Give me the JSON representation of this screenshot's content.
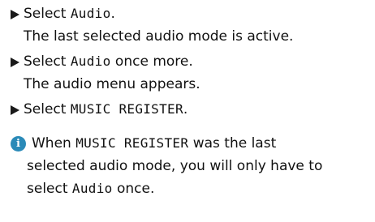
{
  "steps": [
    {
      "line1_prefix": "Select ",
      "line1_code": "Audio",
      "line1_suffix": ".",
      "line2": "The last selected audio mode is active."
    },
    {
      "line1_prefix": "Select ",
      "line1_code": "Audio",
      "line1_suffix": " once more.",
      "line2": "The audio menu appears."
    },
    {
      "line1_prefix": "Select ",
      "line1_code": "MUSIC REGISTER",
      "line1_suffix": "."
    }
  ],
  "info": {
    "icon": "info-icon",
    "icon_glyph": "i",
    "icon_color": "#2a8ab8",
    "line1_prefix": "When ",
    "line1_code": "MUSIC REGISTER",
    "line1_suffix": " was the last",
    "line2": "selected audio mode, you will only have to",
    "line3_prefix": "select ",
    "line3_code": "Audio",
    "line3_suffix": " once."
  }
}
